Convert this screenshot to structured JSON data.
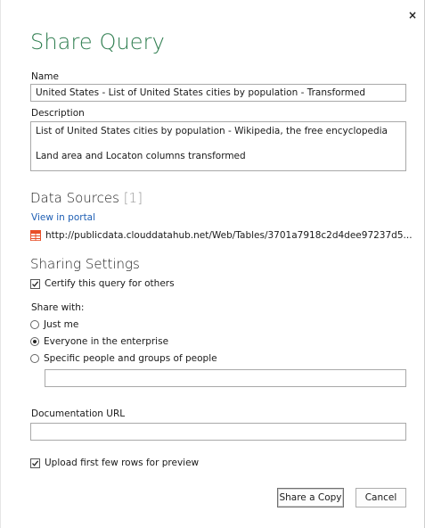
{
  "dialog": {
    "title": "Share Query",
    "close_glyph": "×"
  },
  "name": {
    "label": "Name",
    "value": "United States - List of United States cities by population - Transformed"
  },
  "description": {
    "label": "Description",
    "lines": [
      "List of United States cities by population - Wikipedia, the free encyclopedia",
      "",
      "Land area and Locaton columns transformed"
    ]
  },
  "data_sources": {
    "heading": "Data Sources",
    "count": "[1]",
    "view_link": "View in portal",
    "items": [
      {
        "icon": "table-icon",
        "url": "http://publicdata.clouddatahub.net/Web/Tables/3701a7918c2d4dee97237d5..."
      }
    ]
  },
  "sharing": {
    "heading": "Sharing Settings",
    "certify_label": "Certify this query for others",
    "certify_checked": true,
    "share_with_label": "Share with:",
    "options": [
      {
        "label": "Just me",
        "selected": false
      },
      {
        "label": "Everyone in the enterprise",
        "selected": true
      },
      {
        "label": "Specific people and groups of people",
        "selected": false
      }
    ],
    "people_value": ""
  },
  "documentation": {
    "label": "Documentation URL",
    "value": ""
  },
  "upload": {
    "label": "Upload first few rows for preview",
    "checked": true
  },
  "buttons": {
    "share": "Share a Copy",
    "cancel": "Cancel"
  },
  "colors": {
    "title": "#2e7d4f",
    "link": "#1f5fb4",
    "icon": "#e8502a"
  }
}
